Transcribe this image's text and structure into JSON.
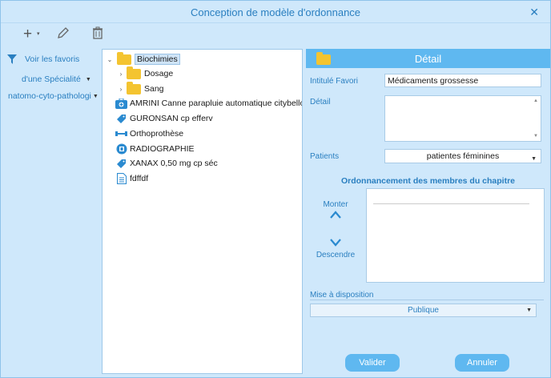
{
  "window": {
    "title": "Conception de modèle d'ordonnance"
  },
  "left": {
    "fav_link": "Voir les favoris",
    "specialty_dropdown": "d'une Spécialité",
    "category_dropdown": "natomo-cyto-pathologi"
  },
  "tree": {
    "items": [
      {
        "label": "Biochimies",
        "icon": "folder-icon",
        "chevron": "chevron-down-icon",
        "selected": true
      },
      {
        "label": "Dosage",
        "icon": "folder-icon",
        "chevron": "chevron-right-icon"
      },
      {
        "label": "Sang",
        "icon": "folder-icon",
        "chevron": "chevron-right-icon"
      },
      {
        "label": "AMRINI Canne parapluie automatique citybello bleu",
        "icon": "medical-kit-icon"
      },
      {
        "label": "GURONSAN cp efferv",
        "icon": "drug-tag-icon"
      },
      {
        "label": "Orthoprothèse",
        "icon": "prosthesis-icon"
      },
      {
        "label": "RADIOGRAPHIE",
        "icon": "radiography-icon"
      },
      {
        "label": "XANAX 0,50 mg cp séc",
        "icon": "drug-tag-icon"
      },
      {
        "label": "fdffdf",
        "icon": "document-icon"
      }
    ]
  },
  "detail": {
    "header": "Détail",
    "favori_label": "Intitulé Favori",
    "favori_value": "Médicaments grossesse",
    "detail_label": "Détail",
    "detail_value": "",
    "patients_label": "Patients",
    "patients_value": "patientes féminines",
    "ordering_title": "Ordonnancement des membres du chapitre",
    "up_label": "Monter",
    "down_label": "Descendre",
    "availability_label": "Mise à disposition",
    "availability_value": "Publique",
    "validate_button": "Valider",
    "cancel_button": "Annuler"
  },
  "colors": {
    "accent": "#2a7fc0",
    "header": "#5fb8f0",
    "window_bg": "#cfe8fb",
    "folder": "#f4c430"
  }
}
